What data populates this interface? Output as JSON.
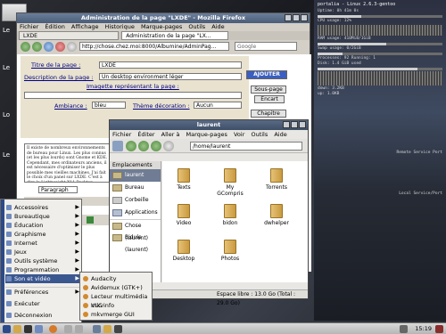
{
  "desktop": {
    "icons": [
      {
        "label": "Le"
      },
      {
        "label": "Le"
      },
      {
        "label": "Lo"
      },
      {
        "label": "Le"
      }
    ]
  },
  "conky": {
    "title": "portalia - Linux 2.6.3-gentoo",
    "lines": [
      "Uptime: 0h 41m 0s",
      "CPU usage: 12%",
      "RAM usage: 410MiB/1GiB",
      "Swap usage: 0/2GiB",
      "Processes: 92 Running: 1",
      "Disk: 1.4 GiB used"
    ],
    "net": [
      "down: 3.2KB",
      "up: 1.0KB"
    ],
    "section1": "Remote Service Port",
    "section2": "Local Service/Port",
    "bars": [
      0.35,
      0.55,
      0.2,
      0.8
    ]
  },
  "firefox": {
    "title": "Administration de la page \"LXDE\" - Mozilla Firefox",
    "menu": [
      "Fichier",
      "Édition",
      "Affichage",
      "Historique",
      "Marque-pages",
      "Outils",
      "Aide"
    ],
    "tabs": [
      "LXDE",
      "Administration de la page \"LX..."
    ],
    "url": "http://chose.chez.moi:8000/Albumine/AdminPag...",
    "search_placeholder": "Google",
    "form": {
      "titre_label": "Titre de la page :",
      "titre_value": "LXDE",
      "desc_label": "Description de la page :",
      "desc_value": "Un desktop environment léger",
      "image_label": "Imagette représentant la page :",
      "ambiance_label": "Ambiance :",
      "ambiance_value": "bleu",
      "theme_label": "Thème décoration :",
      "theme_value": "Aucun",
      "ajouter": "AJOUTER",
      "sous_page": "Sous-page",
      "encart": "Encart",
      "chapitre": "Chapitre",
      "article": "Il existe de nombreux environnements de bureau pour Linux. Les plus connus (et les plus lourds) sont Gnome et KDE. Cependant, mes ordinateurs anciens, il est nécessaire d'optimiser le plus possible mes vieilles machines. J'ai fait le choix d'un panel sur LXDE. C'est à dire le Lightweight X11 Desktop Environment (léger) tout bon sur les processus.",
      "paragraph": "Paragraph"
    }
  },
  "filemanager": {
    "title": "laurent",
    "menu": [
      "Fichier",
      "Éditer",
      "Aller à",
      "Marque-pages",
      "Voir",
      "Outils",
      "Aide"
    ],
    "path": "/home/laurent",
    "sidebar_header": "Emplacements",
    "places": [
      "laurent",
      "Bureau",
      "Corbeille",
      "Applications",
      "Chose (laurent)",
      "Bidule (laurent)"
    ],
    "folders": [
      "Texts",
      "My GCompris",
      "Torrents",
      "Video",
      "bidon",
      "dwhelper",
      "Desktop",
      "Photos"
    ],
    "status": "Espace libre : 13.0 Go (Total : 29.0 Go)"
  },
  "menu": {
    "items": [
      "Accessoires",
      "Bureautique",
      "Éducation",
      "Graphisme",
      "Internet",
      "Jeux",
      "Outils système",
      "Programmation",
      "Son et vidéo",
      "Préférences",
      "Exécuter",
      "Déconnexion"
    ],
    "submenu": [
      "Audacity",
      "Avidemux (GTK+)",
      "Lecteur multimédia VLC",
      "mkvinfo",
      "mkvmerge GUI"
    ]
  },
  "taskbar": {
    "clock": "15:19"
  }
}
